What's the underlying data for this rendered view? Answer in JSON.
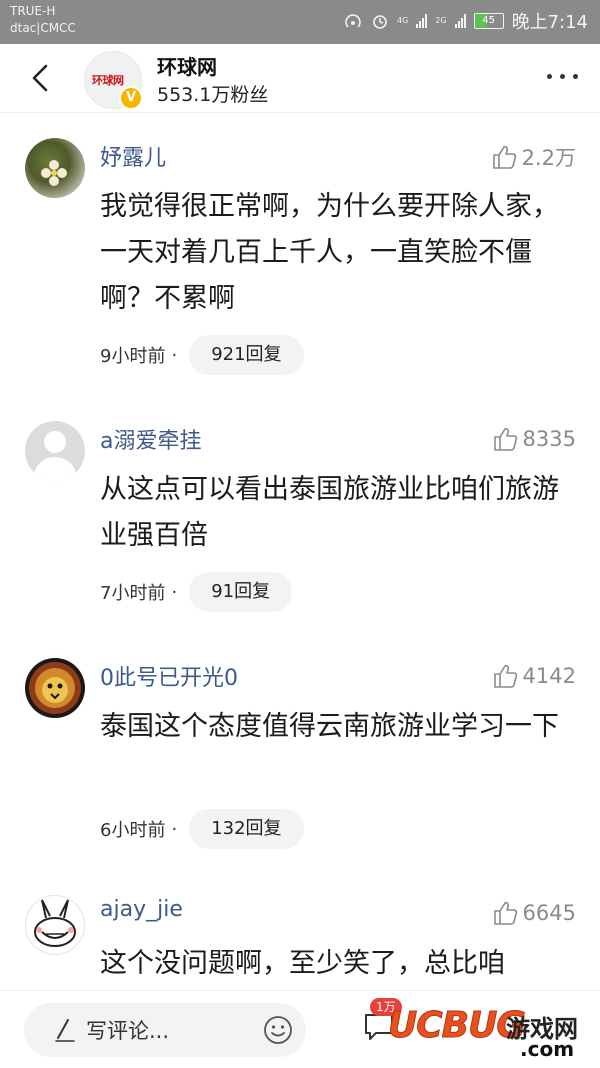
{
  "status_bar": {
    "carrier_1": "TRUE-H",
    "carrier_2": "dtac|CMCC",
    "battery": "45",
    "time": "晚上7:14",
    "net_1": "4G",
    "net_2": "2G"
  },
  "header": {
    "account_name": "环球网",
    "followers": "553.1万粉丝",
    "logo_text": "环球网",
    "verified_mark": "V"
  },
  "comments": [
    {
      "user": "妤露儿",
      "likes": "2.2万",
      "text": "我觉得很正常啊，为什么要开除人家，一天对着几百上千人，一直笑脸不僵啊？不累啊",
      "time": "9小时前",
      "separator": "·",
      "replies": "921回复",
      "avatar": "flower-photo"
    },
    {
      "user": "a溺爱牵挂",
      "likes": "8335",
      "text": "从这点可以看出泰国旅游业比咱们旅游业强百倍",
      "time": "7小时前",
      "separator": "·",
      "replies": "91回复",
      "avatar": "default-user"
    },
    {
      "user": "0此号已开光0",
      "likes": "4142",
      "text": "泰国这个态度值得云南旅游业学习一下",
      "time": "6小时前",
      "separator": "·",
      "replies": "132回复",
      "avatar": "lion-art"
    },
    {
      "user": "ajay_jie",
      "likes": "6645",
      "text": "这个没问题啊，至少笑了，总比咱",
      "avatar": "rabbit-cartoon"
    }
  ],
  "bottom_bar": {
    "write_placeholder": "写评论...",
    "comment_badge": "1万",
    "watermark_main": "UCBUG",
    "watermark_cn": "游戏网",
    "watermark_domain": ".com"
  },
  "colors": {
    "username": "#3d5a8c",
    "status_bar_bg": "#8a8a8a",
    "reply_pill_bg": "#f2f3f5",
    "verified_badge": "#f7b500",
    "badge_red": "#e8403a"
  }
}
